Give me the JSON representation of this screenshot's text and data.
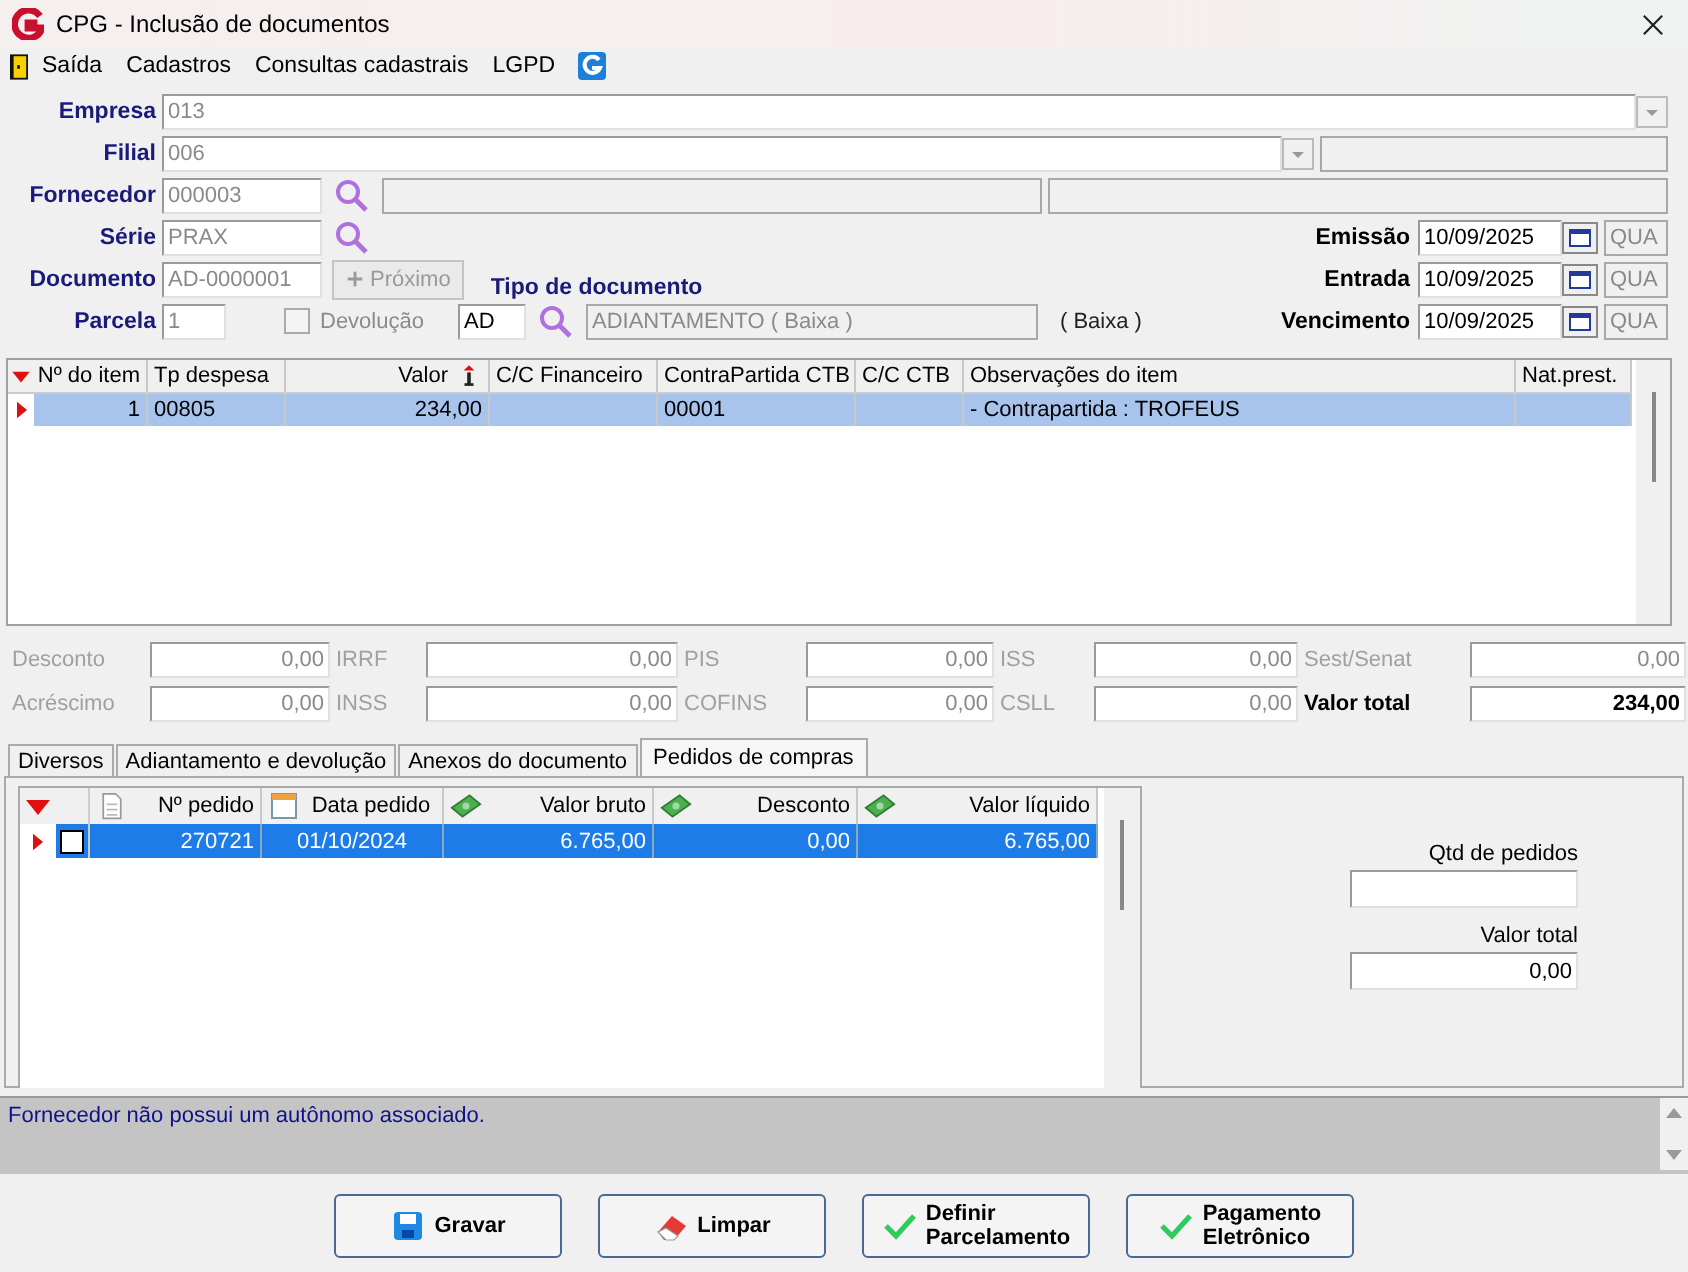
{
  "window": {
    "title": "CPG - Inclusão de documentos"
  },
  "menu": [
    {
      "label": "Saída",
      "kind": "exit"
    },
    {
      "label": "Cadastros",
      "kind": "plain"
    },
    {
      "label": "Consultas cadastrais",
      "kind": "plain"
    },
    {
      "label": "LGPD",
      "kind": "plain"
    }
  ],
  "form": {
    "empresa": {
      "label": "Empresa",
      "value": "013",
      "disabled": true
    },
    "filial": {
      "label": "Filial",
      "value": "006",
      "disabled": true
    },
    "fornecedor": {
      "label": "Fornecedor",
      "value": "000003",
      "disabled": true
    },
    "serie": {
      "label": "Série",
      "value": "PRAX",
      "disabled": true
    },
    "documento": {
      "label": "Documento",
      "value": "AD-0000001",
      "disabled": true
    },
    "proximo_button": {
      "label": "Próximo",
      "disabled": true
    },
    "parcela": {
      "label": "Parcela",
      "value": "1",
      "disabled": true
    },
    "devolucao": {
      "label": "Devolução",
      "checked": false,
      "disabled": true
    },
    "tipo_documento": {
      "label": "Tipo de documento",
      "code": "AD",
      "description": "ADIANTAMENTO ( Baixa )",
      "suffix": "( Baixa )"
    },
    "dates": [
      {
        "label": "Emissão",
        "value": "10/09/2025",
        "weekday": "QUA"
      },
      {
        "label": "Entrada",
        "value": "10/09/2025",
        "weekday": "QUA"
      },
      {
        "label": "Vencimento",
        "value": "10/09/2025",
        "weekday": "QUA"
      }
    ]
  },
  "items_grid": {
    "columns": [
      {
        "label": "Nº do item"
      },
      {
        "label": "Tp despesa"
      },
      {
        "label": "Valor",
        "sorted": true
      },
      {
        "label": "C/C Financeiro"
      },
      {
        "label": "ContraPartida CTB"
      },
      {
        "label": "C/C CTB"
      },
      {
        "label": "Observações do item"
      },
      {
        "label": "Nat.prest."
      }
    ],
    "rows": [
      {
        "selected": true,
        "cells": [
          "1",
          "00805",
          "234,00",
          null,
          "00001",
          null,
          "- Contrapartida : TROFEUS",
          null
        ]
      }
    ]
  },
  "totals": [
    {
      "label": "Desconto",
      "value": "0,00",
      "disabled": true
    },
    {
      "label": "IRRF",
      "value": "0,00",
      "disabled": true
    },
    {
      "label": "PIS",
      "value": "0,00",
      "disabled": true
    },
    {
      "label": "ISS",
      "value": "0,00",
      "disabled": true
    },
    {
      "label": "Sest/Senat",
      "value": "0,00",
      "disabled": true
    },
    {
      "label": "Acréscimo",
      "value": "0,00",
      "disabled": true
    },
    {
      "label": "INSS",
      "value": "0,00",
      "disabled": true
    },
    {
      "label": "COFINS",
      "value": "0,00",
      "disabled": true
    },
    {
      "label": "CSLL",
      "value": "0,00",
      "disabled": true
    },
    {
      "label": "Valor total",
      "value": "234,00",
      "disabled": false
    }
  ],
  "tabs": [
    {
      "label": "Diversos",
      "selected": false
    },
    {
      "label": "Adiantamento e devolução",
      "selected": false
    },
    {
      "label": "Anexos do documento",
      "selected": false
    },
    {
      "label": "Pedidos de compras",
      "selected": true
    }
  ],
  "orders_grid": {
    "columns": [
      {
        "label": "Nº pedido"
      },
      {
        "label": "Data pedido"
      },
      {
        "label": "Valor bruto"
      },
      {
        "label": "Desconto"
      },
      {
        "label": "Valor líquido"
      }
    ],
    "rows": [
      {
        "selected": true,
        "checked": false,
        "cells": [
          "270721",
          "01/10/2024",
          "6.765,00",
          "0,00",
          "6.765,00"
        ]
      }
    ]
  },
  "orders_summary": {
    "count_label": "Qtd de pedidos",
    "total_label": "Valor total",
    "total_value": "0,00"
  },
  "message": "Fornecedor não possui um autônomo associado.",
  "buttons": [
    {
      "lines": [
        "Gravar"
      ],
      "kind": "save"
    },
    {
      "lines": [
        "Limpar"
      ],
      "kind": "eraser"
    },
    {
      "lines": [
        "Definir",
        "Parcelamento"
      ],
      "kind": "check"
    },
    {
      "lines": [
        "Pagamento",
        "Eletrônico"
      ],
      "kind": "check"
    }
  ]
}
